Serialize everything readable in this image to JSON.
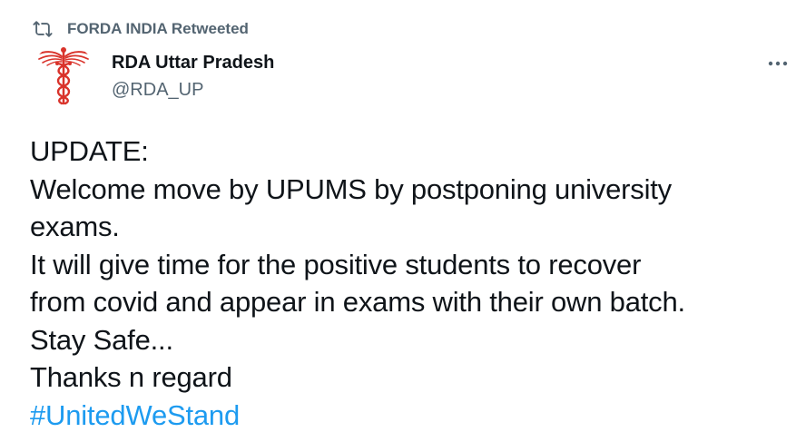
{
  "retweet": {
    "icon": "retweet-icon",
    "label": "FORDA INDIA Retweeted"
  },
  "author": {
    "avatar": "caduceus-logo",
    "display_name": "RDA Uttar Pradesh",
    "handle": "@RDA_UP"
  },
  "more_icon": "more-icon",
  "tweet": {
    "lines": [
      "UPDATE:",
      "Welcome move by UPUMS by postponing university",
      "exams.",
      "It will give time for the positive students to recover",
      "from covid and appear in exams with their own batch.",
      "Stay Safe...",
      "Thanks n regard"
    ],
    "hashtag": "#UnitedWeStand"
  },
  "colors": {
    "text": "#0f1419",
    "secondary": "#536471",
    "link": "#1d9bf0",
    "logo": "#d9332b"
  }
}
